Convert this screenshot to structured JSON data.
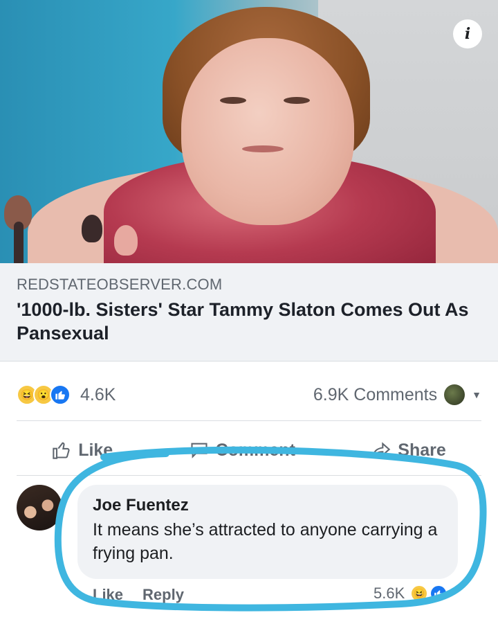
{
  "post": {
    "photo_icon": "person-photo",
    "info_button_icon": "info-icon",
    "info_button_glyph": "i"
  },
  "link_preview": {
    "domain": "REDSTATEOBSERVER.COM",
    "title": "'1000-lb. Sisters' Star Tammy Slaton Comes Out As Pansexual"
  },
  "reactions": {
    "icons": [
      "haha-emoji-icon",
      "wow-emoji-icon",
      "like-emoji-icon"
    ],
    "count": "4.6K",
    "comments_count": "6.9K Comments"
  },
  "actions": {
    "like_label": "Like",
    "comment_label": "Comment",
    "share_label": "Share"
  },
  "comment": {
    "author": "Joe Fuentez",
    "text": "It means she’s attracted to anyone carrying a frying pan.",
    "like_label": "Like",
    "reply_label": "Reply",
    "reaction_count": "5.6K"
  },
  "colors": {
    "highlight": "#3fb6e0",
    "bubble": "#f0f2f5",
    "secondary_text": "#606770",
    "like_blue": "#1877f2"
  }
}
